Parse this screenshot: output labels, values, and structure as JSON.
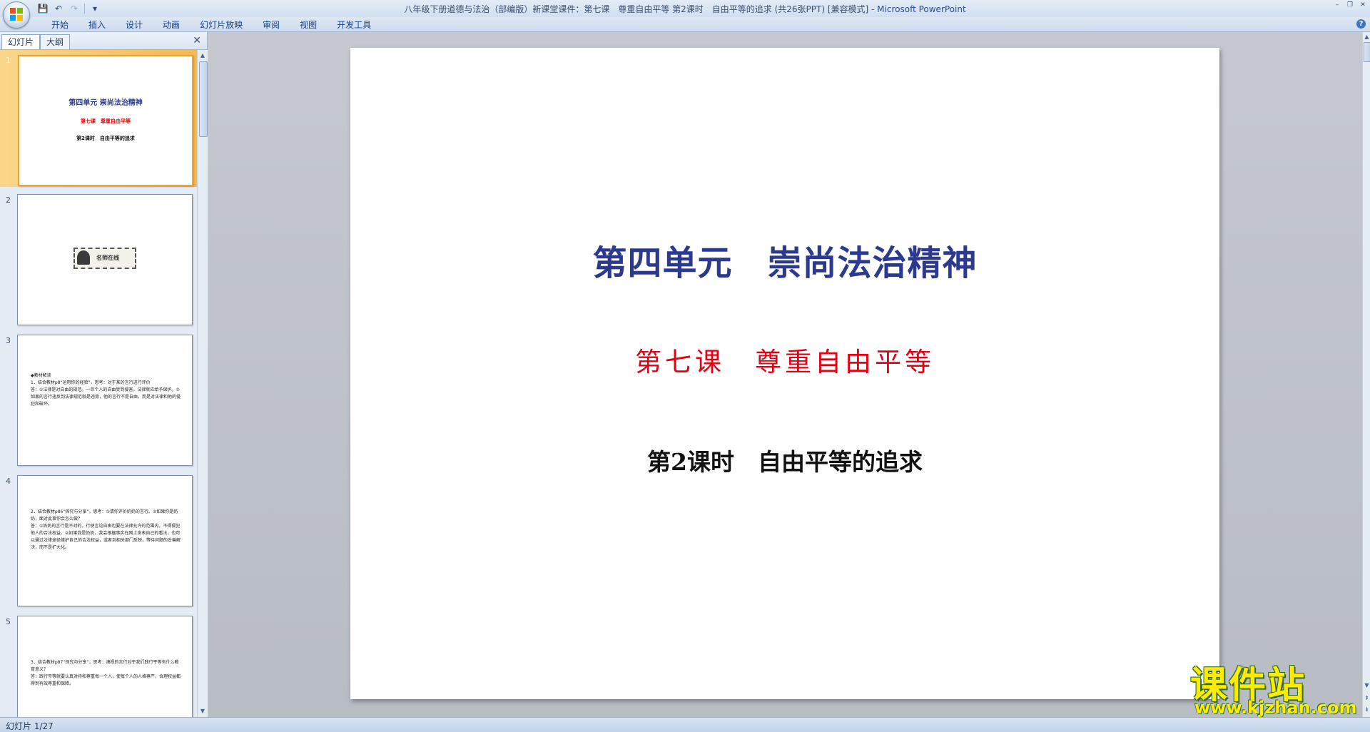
{
  "window": {
    "title": "八年级下册道德与法治（部编版）新课堂课件：第七课　尊重自由平等 第2课时　自由平等的追求 (共26张PPT) [兼容模式] - ",
    "app_name": "Microsoft PowerPoint"
  },
  "quick_access": {
    "save_icon": "💾",
    "undo_icon": "↶",
    "redo_icon": "↷",
    "menu_icon": "▾"
  },
  "window_controls": {
    "minimize": "–",
    "restore": "❐",
    "close": "✕"
  },
  "ribbon": {
    "tabs": [
      "开始",
      "插入",
      "设计",
      "动画",
      "幻灯片放映",
      "审阅",
      "视图",
      "开发工具"
    ],
    "help": "?"
  },
  "pane": {
    "tabs": [
      "幻灯片",
      "大纲"
    ],
    "close": "✕"
  },
  "thumbnails": [
    {
      "num": "1",
      "title": "第四单元  崇尚法治精神",
      "subtitle": "第七课　尊重自由平等",
      "lesson": "第2课时　自由平等的追求"
    },
    {
      "num": "2",
      "stamp": "名师在线"
    },
    {
      "num": "3",
      "text": "◆教材解读\n1．结合教材p8“运用你的经验”，思考：对于某的言行进行评价\n答：①法律是对自由的规范。一旦个人的自由受到侵害，法律就应给予保护。②如果的言行违反到法律规范就是违背，他的言行不是自由，而是对法律和他的侵犯和破坏。"
    },
    {
      "num": "4",
      "text": "2．结合教材p86“探究与分享”，思考：①请你评价奶奶的言行。②如果你是奶奶，面对此事你会怎么做？\n答：①奶奶的言行是不对的，行使言论自由也要在法律允许的范围内，不得侵犯他人的合法权益。②如果我是奶奶，我会根据事实在网上发表自己的看法，也可以通过法律途径维护自己的合法权益，或者到相关部门反映，等待问题的妥善解决，而不是扩大化。"
    },
    {
      "num": "5",
      "text": "3．结合教材p87“探究与分享”，思考：漠视的言行对于我们践行平等有什么教育意义？\n答：践行平等就要认真对待和尊重每一个人，使每个人的人格尊严，合理权益都得到有效尊重和保障。"
    }
  ],
  "slide": {
    "title": "第四单元　崇尚法治精神",
    "subtitle": "第七课　尊重自由平等",
    "lesson": "第2课时　自由平等的追求"
  },
  "watermark": {
    "text": "课件站",
    "url": "www.kjzhan.com"
  },
  "status": {
    "slide_info": "幻灯片 1/27"
  },
  "scrollbar": {
    "up": "▲",
    "down": "▼",
    "prev": "⇞",
    "next": "⇟"
  }
}
